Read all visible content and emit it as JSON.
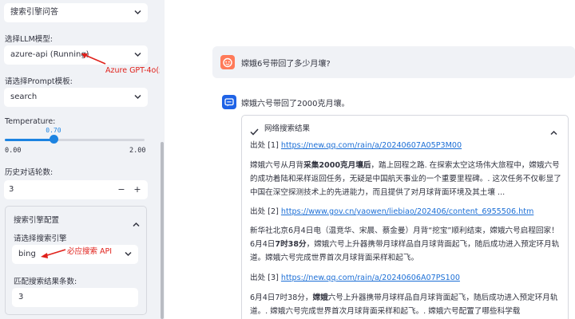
{
  "sidebar": {
    "header_select": "搜索引擎问答",
    "llm_label": "选择LLM模型:",
    "llm_value": "azure-api (Running)",
    "prompt_label": "请选择Prompt模板:",
    "prompt_value": "search",
    "temperature_label": "Temperature:",
    "temperature_value": "0.70",
    "temperature_fraction": 0.35,
    "temperature_min": "0.00",
    "temperature_max": "2.00",
    "history_label": "历史对话轮数:",
    "history_value": "3",
    "minus": "−",
    "plus": "+",
    "engine_section_title": "搜索引擎配置",
    "engine_label": "请选择搜索引擎",
    "engine_value": "bing",
    "match_count_label": "匹配搜索结果条数:",
    "match_count_value": "3"
  },
  "annotations": {
    "azure": "Azure GPT-4o(最新版)",
    "search_api": "必应搜索 API"
  },
  "chat": {
    "user_question": "嫦娥6号带回了多少月壤?",
    "assistant_answer": "嫦娥六号带回了2000克月壤。",
    "results_title": "网络搜索结果",
    "sources": [
      {
        "label": "出处 [1]",
        "url": "https://new.qq.com/rain/a/20240607A05P3M00",
        "pre": "嫦娥六号从月背",
        "bold": "采集2000克月壤后",
        "post": "，踏上回程之路. 在探索太空这场伟大旅程中，嫦娥六号的成功着陆和采样返回任务，无疑是中国航天事业的一个重要里程碑。. 这次任务不仅彰显了中国在深空探测技术上的先进能力，而且提供了对月球背面环境及其土壤 ..."
      },
      {
        "label": "出处 [2]",
        "url": "https://www.gov.cn/yaowen/liebiao/202406/content_6955506.htm",
        "pre": "新华社北京6月4日电（温竞华、宋晨、蔡金曼）月背“挖宝”顺利结束，嫦娥六号启程回家！6月4日",
        "bold": "7时38分",
        "post": "，嫦娥六号上升器携带月球样品自月球背面起飞，随后成功进入预定环月轨道。嫦娥六号完成世界首次月球背面采样和起飞。"
      },
      {
        "label": "出处 [3]",
        "url": "https://new.qq.com/rain/a/20240606A07PS100",
        "pre": "6月4日7时38分，",
        "bold": "嫦娥",
        "post": "六号上升器携带月球样品自月球背面起飞，随后成功进入预定环月轨道。. 嫦娥六号完成世界首次月球背面采样和起飞。. 嫦娥六号配置了哪些科学载"
      }
    ]
  },
  "colors": {
    "accent": "#1c83e1",
    "annotation_red": "#e0211b",
    "user_avatar": "#ff7a59",
    "assistant_avatar": "#1f63e6"
  }
}
